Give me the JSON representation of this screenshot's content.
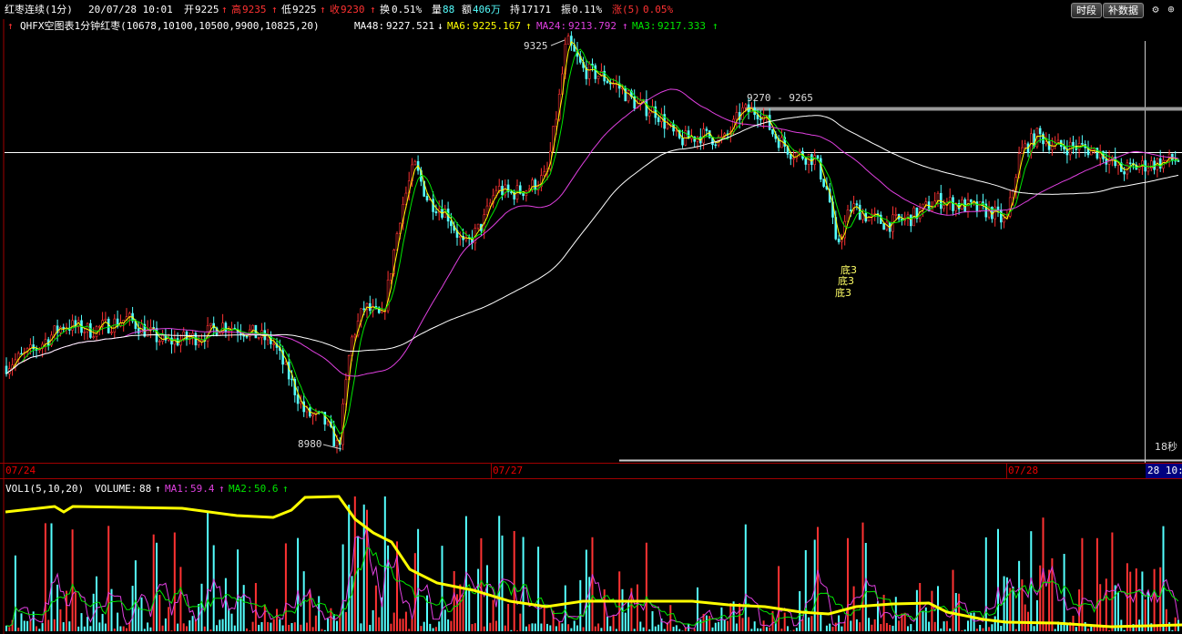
{
  "header": {
    "name": "红枣连续(1分)",
    "date_time": "20/07/28 10:01",
    "open_label": "开",
    "open": "9225",
    "high_label": "高",
    "high": "9235",
    "low_label": "低",
    "low": "9225",
    "close_label": "收",
    "close": "9230",
    "turnover_label": "换",
    "turnover": "0.51%",
    "volume_label": "量",
    "volume": "88",
    "amount_label": "额",
    "amount": "406万",
    "hold_label": "持",
    "hold": "17171",
    "amplitude_label": "振",
    "amplitude": "0.11%",
    "change_label": "涨(5)",
    "change": "0.05%",
    "up_arrow": "↑"
  },
  "toolbar": {
    "time_segment_label": "时段",
    "fill_data_label": "补数据",
    "settings_icon": "gear-icon",
    "zoom_icon": "magnifier-icon"
  },
  "indicator_main": {
    "formula": "QHFX空图表1分钟红枣(10678,10100,10500,9900,10825,20)",
    "ma48_label": "MA48:",
    "ma48": "9227.521",
    "ma48_arrow": "↓",
    "ma6_label": "MA6:",
    "ma6": "9225.167",
    "ma6_arrow": "↑",
    "ma24_label": "MA24:",
    "ma24": "9213.792",
    "ma24_arrow": "↑",
    "ma3_label": "MA3:",
    "ma3": "9217.333",
    "ma3_arrow": "↑"
  },
  "indicator_volume": {
    "formula": "VOL1(5,10,20)",
    "volume_label": "VOLUME:",
    "volume": "88",
    "ma1_label": "MA1:",
    "ma1": "59.4",
    "ma2_label": "MA2:",
    "ma2": "50.6",
    "arrow": "↑"
  },
  "annotations": {
    "peak_label": "9325",
    "trough_label": "8980",
    "range_label": "9270 - 9265",
    "signal_1": "底3",
    "signal_2": "底3",
    "signal_3": "底3",
    "countdown": "18秒"
  },
  "x_axis": {
    "dates": [
      "07/24",
      "07/27",
      "07/28"
    ],
    "cursor_label": "28 10:"
  },
  "colors": {
    "up": "#ff3232",
    "down": "#54ffff",
    "ma3": "#ffff00",
    "ma6": "#00e600",
    "ma24": "#e040e0",
    "ma48": "#ffffff",
    "grid": "#a00000",
    "vol_line": "#ffff00"
  },
  "chart_data": {
    "type": "candlestick",
    "price_range": [
      8980,
      9325
    ],
    "price_peak": 9325,
    "price_trough": 8980,
    "price_segments": [
      {
        "time": "07/24",
        "close_min": 9048,
        "close_max": 9110
      },
      {
        "time": "07/27",
        "close_min": 8980,
        "close_max": 9325
      },
      {
        "time": "07/28",
        "close_min": 9185,
        "close_max": 9245
      }
    ],
    "last_close": 9230,
    "series": [
      {
        "name": "MA48",
        "last": 9227.521
      },
      {
        "name": "MA6",
        "last": 9225.167
      },
      {
        "name": "MA24",
        "last": 9213.792
      },
      {
        "name": "MA3",
        "last": 9217.333
      }
    ],
    "volume": {
      "last": 88,
      "MA1": 59.4,
      "MA2": 50.6
    }
  }
}
